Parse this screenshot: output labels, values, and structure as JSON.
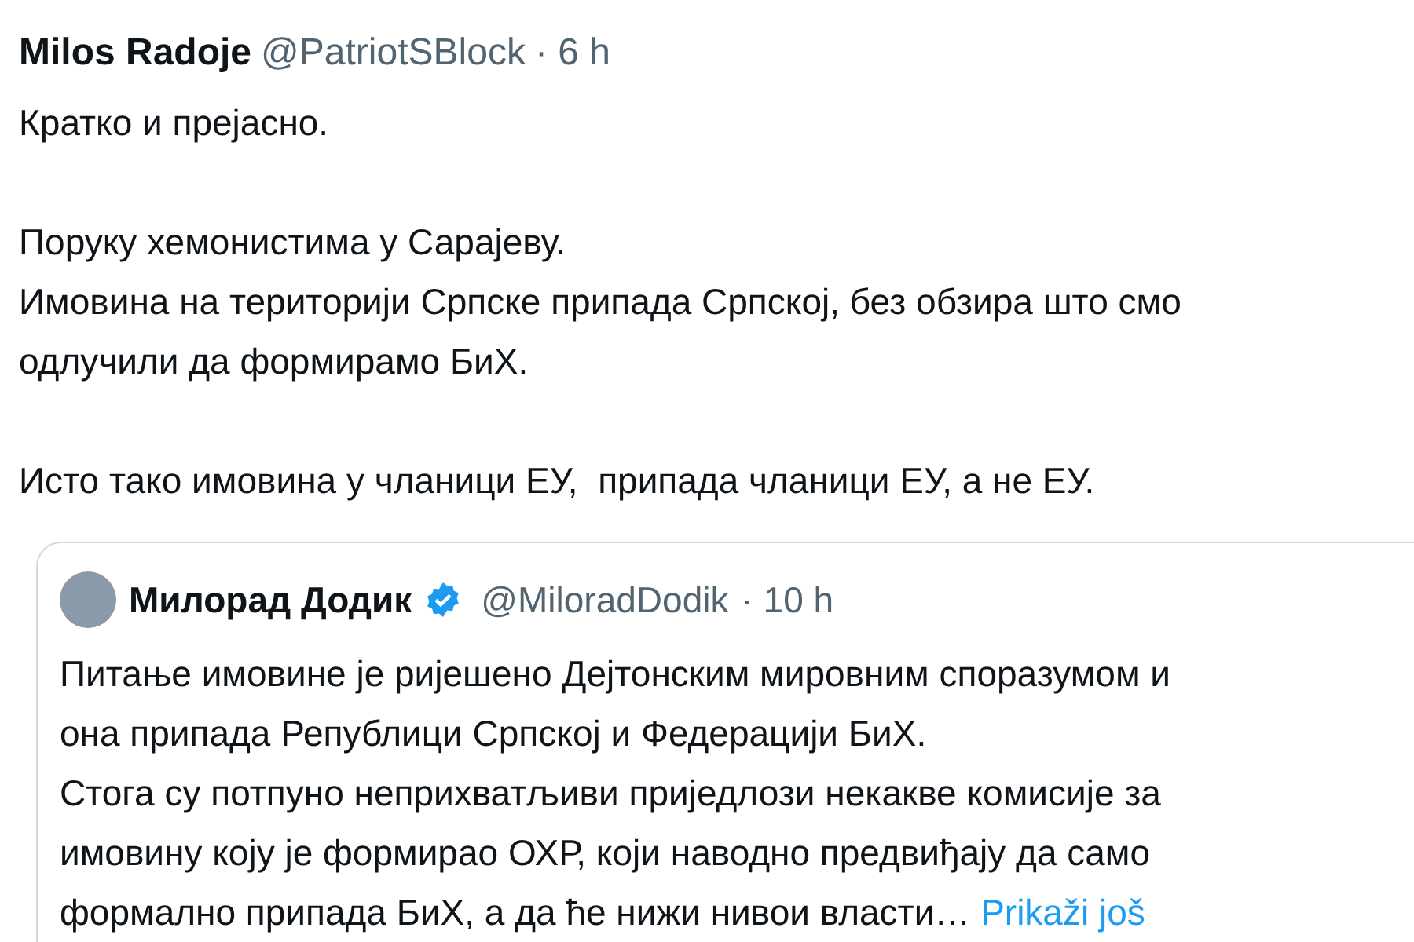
{
  "tweet": {
    "author": {
      "name": "Milos Radoje",
      "handle": "@PatriotSBlock",
      "time": "· 6 h"
    },
    "paragraphs": [
      [
        "Кратко и прејасно."
      ],
      [
        "Поруку хемонистима у Сарајеву.",
        "Имовина на територији Српске припада Српској, без обзира што смо",
        "одлучили да формирамо БиХ."
      ],
      [
        "Исто тако имовина у чланици ЕУ,  припада чланици ЕУ, а не ЕУ."
      ]
    ],
    "quote": {
      "author": {
        "name": "Милорад Додик",
        "verified": true,
        "handle": "@MiloradDodik",
        "time": "· 10 h"
      },
      "lines": [
        "Питање имовине је ријешено Дејтонским мировним споразумом и",
        "она припада Републици Српској и Федерацији БиХ.",
        "Стога су потпуно неприхватљиви приједлози некакве комисије за",
        "имовину коју је формирао ОХР, који наводно предвиђају да само",
        "формално припада БиХ, а да ће нижи нивои власти…"
      ],
      "show_more": "Prikaži još"
    }
  }
}
